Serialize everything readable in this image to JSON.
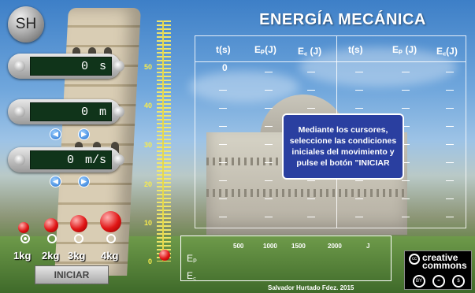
{
  "app": {
    "logo": "SH",
    "title": "ENERGÍA MECÁNICA"
  },
  "inputs": {
    "time": {
      "value": "0",
      "unit": "s"
    },
    "height": {
      "value": "0",
      "unit": "m"
    },
    "speed": {
      "value": "0",
      "unit": "m/s"
    }
  },
  "ruler": {
    "labels": [
      "50",
      "40",
      "30",
      "20",
      "10",
      "0"
    ]
  },
  "table": {
    "headers": [
      "t(s)",
      "Eₚ(J)",
      "E꜀ (J)",
      "t(s)",
      "Eₚ (J)",
      "E꜀(J)"
    ],
    "first_value": "0"
  },
  "message": "Mediante los cursores, seleccione las condiciones iniciales del movimiento y pulse el botón \"INICIAR",
  "energy_panel": {
    "ep_label": "Eₚ",
    "ec_label": "E꜀",
    "scale": [
      "500",
      "1000",
      "1500",
      "2000",
      "J"
    ]
  },
  "masses": [
    {
      "label": "1kg",
      "selected": true
    },
    {
      "label": "2kg",
      "selected": false
    },
    {
      "label": "3kg",
      "selected": false
    },
    {
      "label": "4kg",
      "selected": false
    }
  ],
  "start_button": "INICIAR",
  "author": "Salvador Hurtado Fdez. 2015",
  "license": {
    "word1": "creative",
    "word2": "commons",
    "icons": [
      "by-icon",
      "nd-icon",
      "nc-icon"
    ]
  }
}
